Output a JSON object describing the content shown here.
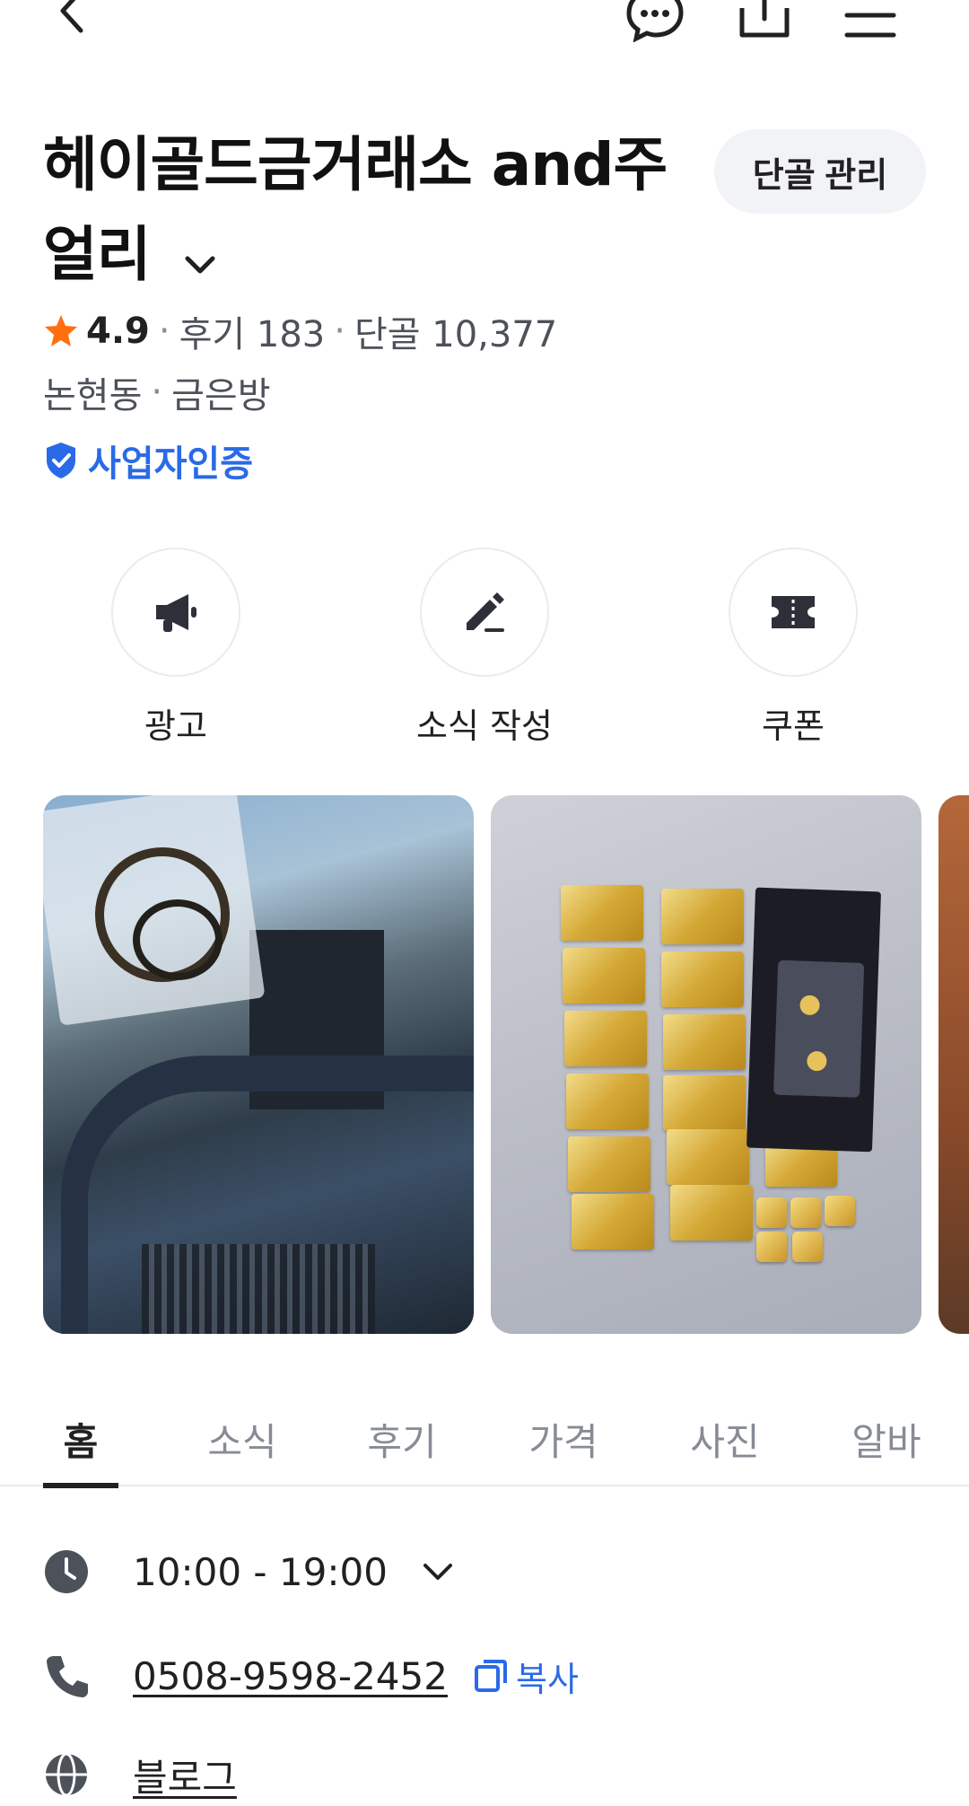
{
  "store": {
    "name": "헤이골드금거래소 and주얼리",
    "regular_manage_label": "단골 관리",
    "rating": "4.9",
    "reviews": "후기 183",
    "regulars": "단골 10,377",
    "neighborhood": "논현동",
    "category": "금은방",
    "verified_label": "사업자인증"
  },
  "actions": [
    {
      "label": "광고",
      "icon": "megaphone-icon"
    },
    {
      "label": "소식 작성",
      "icon": "pencil-icon"
    },
    {
      "label": "쿠폰",
      "icon": "coupon-icon"
    }
  ],
  "tabs": [
    "홈",
    "소식",
    "후기",
    "가격",
    "사진",
    "알바"
  ],
  "info": {
    "hours": "10:00 - 19:00",
    "phone": "0508-9598-2452",
    "copy_label": "복사",
    "blog": "블로그"
  },
  "colors": {
    "accent_blue": "#2a6ae8",
    "star_orange": "#ff6f0f",
    "text_primary": "#212124",
    "text_secondary": "#4d5159"
  }
}
